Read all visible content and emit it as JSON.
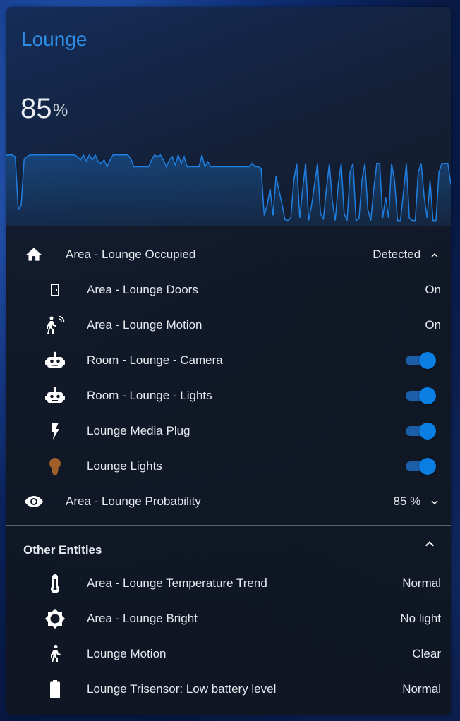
{
  "card": {
    "title": "Lounge",
    "state_value": "85",
    "state_unit": "%",
    "graph_series": [
      0.2,
      0.2,
      0.2,
      0.22,
      0.85,
      0.8,
      0.25,
      0.22,
      0.2,
      0.2,
      0.2,
      0.2,
      0.2,
      0.2,
      0.2,
      0.2,
      0.2,
      0.2,
      0.2,
      0.2,
      0.2,
      0.2,
      0.2,
      0.2,
      0.22,
      0.26,
      0.2,
      0.27,
      0.2,
      0.26,
      0.2,
      0.28,
      0.3,
      0.26,
      0.34,
      0.26,
      0.2,
      0.2,
      0.2,
      0.2,
      0.2,
      0.2,
      0.24,
      0.34,
      0.34,
      0.34,
      0.34,
      0.34,
      0.34,
      0.26,
      0.2,
      0.22,
      0.2,
      0.26,
      0.34,
      0.26,
      0.22,
      0.32,
      0.2,
      0.3,
      0.22,
      0.34,
      0.34,
      0.34,
      0.34,
      0.34,
      0.2,
      0.34,
      0.28,
      0.34,
      0.34,
      0.34,
      0.34,
      0.34,
      0.34,
      0.34,
      0.34,
      0.34,
      0.34,
      0.34,
      0.34,
      0.34,
      0.34,
      0.3,
      0.34,
      0.34,
      0.36,
      0.92,
      0.8,
      0.6,
      0.92,
      0.45,
      0.62,
      0.78,
      0.97,
      0.98,
      0.95,
      0.5,
      0.3,
      0.95,
      0.6,
      0.3,
      0.98,
      0.8,
      0.55,
      0.3,
      0.9,
      0.96,
      0.6,
      0.3,
      0.75,
      0.98,
      0.55,
      0.3,
      0.9,
      0.98,
      0.4,
      0.3,
      0.98,
      0.96,
      0.5,
      0.3,
      0.85,
      0.98,
      0.6,
      0.3,
      0.3,
      0.95,
      0.7,
      0.95,
      0.3,
      0.5,
      0.98,
      0.98,
      0.65,
      0.3,
      0.95,
      0.98,
      0.98,
      0.4,
      0.3,
      0.7,
      0.95,
      0.5,
      0.98,
      0.98,
      0.4,
      0.3,
      0.3,
      0.3,
      0.55
    ],
    "accent": "#2f8de4",
    "graph_color": "#1f7fe0"
  },
  "entities": [
    {
      "name": "Area - Lounge Occupied",
      "value": "Detected",
      "icon": "home-icon",
      "level": "top",
      "control": "chevron-up"
    },
    {
      "name": "Area - Lounge Doors",
      "value": "On",
      "icon": "door-icon",
      "level": "sub",
      "control": "text"
    },
    {
      "name": "Area - Lounge Motion",
      "value": "On",
      "icon": "motion-sensor-icon",
      "level": "sub",
      "control": "text"
    },
    {
      "name": "Room - Lounge - Camera",
      "value": "",
      "icon": "robot-icon",
      "level": "sub",
      "control": "toggle-on"
    },
    {
      "name": "Room - Lounge - Lights",
      "value": "",
      "icon": "robot-icon",
      "level": "sub",
      "control": "toggle-on"
    },
    {
      "name": "Lounge Media Plug",
      "value": "",
      "icon": "flash-icon",
      "level": "sub",
      "control": "toggle-on"
    },
    {
      "name": "Lounge Lights",
      "value": "",
      "icon": "lightbulb-icon",
      "level": "sub",
      "control": "toggle-on"
    },
    {
      "name": "Area - Lounge Probability",
      "value": "85 %",
      "icon": "eye-icon",
      "level": "top",
      "control": "chevron-down"
    }
  ],
  "other_section": {
    "title": "Other Entities",
    "items": [
      {
        "name": "Area - Lounge Temperature Trend",
        "value": "Normal",
        "icon": "thermometer-icon"
      },
      {
        "name": "Area - Lounge Bright",
        "value": "No light",
        "icon": "brightness-icon"
      },
      {
        "name": "Lounge Motion",
        "value": "Clear",
        "icon": "walk-icon"
      },
      {
        "name": "Lounge Trisensor: Low battery level",
        "value": "Normal",
        "icon": "battery-icon"
      }
    ]
  },
  "colors": {
    "toggle_on": "#0a7ee3",
    "bulb": "#a0602a",
    "text": "#e6e9ee"
  }
}
